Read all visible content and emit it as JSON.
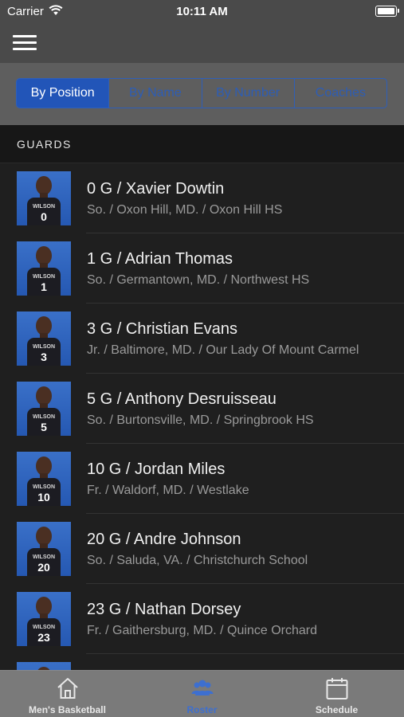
{
  "status": {
    "carrier": "Carrier",
    "time": "10:11 AM"
  },
  "segments": [
    {
      "label": "By Position",
      "active": true
    },
    {
      "label": "By Name",
      "active": false
    },
    {
      "label": "By Number",
      "active": false
    },
    {
      "label": "Coaches",
      "active": false
    }
  ],
  "section": {
    "title": "GUARDS"
  },
  "players": [
    {
      "title": "0 G / Xavier Dowtin",
      "details": "So. / Oxon Hill, MD. / Oxon Hill HS",
      "jersey_team": "WILSON",
      "jersey_number": "0"
    },
    {
      "title": "1 G / Adrian Thomas",
      "details": "So. / Germantown, MD. / Northwest HS",
      "jersey_team": "WILSON",
      "jersey_number": "1"
    },
    {
      "title": "3 G / Christian Evans",
      "details": "Jr. / Baltimore, MD. / Our Lady Of Mount Carmel",
      "jersey_team": "WILSON",
      "jersey_number": "3"
    },
    {
      "title": "5 G / Anthony Desruisseau",
      "details": "So. / Burtonsville, MD. / Springbrook HS",
      "jersey_team": "WILSON",
      "jersey_number": "5"
    },
    {
      "title": "10 G / Jordan Miles",
      "details": "Fr. / Waldorf, MD. / Westlake",
      "jersey_team": "WILSON",
      "jersey_number": "10"
    },
    {
      "title": "20 G / Andre Johnson",
      "details": "So. / Saluda, VA. / Christchurch School",
      "jersey_team": "WILSON",
      "jersey_number": "20"
    },
    {
      "title": "23 G / Nathan Dorsey",
      "details": "Fr. / Gaithersburg, MD. / Quince Orchard",
      "jersey_team": "WILSON",
      "jersey_number": "23"
    },
    {
      "title": "",
      "details": "",
      "jersey_team": "",
      "jersey_number": ""
    }
  ],
  "tabs": [
    {
      "label": "Men's Basketball",
      "icon": "home-icon",
      "active": false
    },
    {
      "label": "Roster",
      "icon": "roster-icon",
      "active": true
    },
    {
      "label": "Schedule",
      "icon": "calendar-icon",
      "active": false
    }
  ],
  "colors": {
    "accent": "#2255b8",
    "tab_active": "#3d6fd0",
    "background": "#1f1f1f"
  }
}
